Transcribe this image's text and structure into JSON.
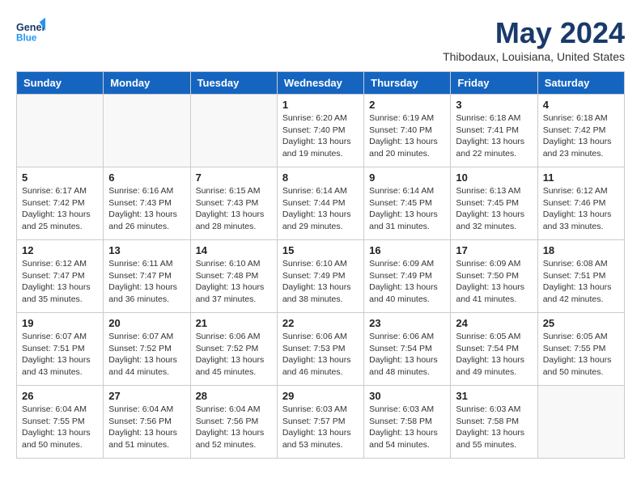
{
  "header": {
    "logo_line1": "General",
    "logo_line2": "Blue",
    "month": "May 2024",
    "location": "Thibodaux, Louisiana, United States"
  },
  "weekdays": [
    "Sunday",
    "Monday",
    "Tuesday",
    "Wednesday",
    "Thursday",
    "Friday",
    "Saturday"
  ],
  "weeks": [
    [
      {
        "day": "",
        "empty": true
      },
      {
        "day": "",
        "empty": true
      },
      {
        "day": "",
        "empty": true
      },
      {
        "day": "1",
        "sunrise": "6:20 AM",
        "sunset": "7:40 PM",
        "daylight": "13 hours and 19 minutes."
      },
      {
        "day": "2",
        "sunrise": "6:19 AM",
        "sunset": "7:40 PM",
        "daylight": "13 hours and 20 minutes."
      },
      {
        "day": "3",
        "sunrise": "6:18 AM",
        "sunset": "7:41 PM",
        "daylight": "13 hours and 22 minutes."
      },
      {
        "day": "4",
        "sunrise": "6:18 AM",
        "sunset": "7:42 PM",
        "daylight": "13 hours and 23 minutes."
      }
    ],
    [
      {
        "day": "5",
        "sunrise": "6:17 AM",
        "sunset": "7:42 PM",
        "daylight": "13 hours and 25 minutes."
      },
      {
        "day": "6",
        "sunrise": "6:16 AM",
        "sunset": "7:43 PM",
        "daylight": "13 hours and 26 minutes."
      },
      {
        "day": "7",
        "sunrise": "6:15 AM",
        "sunset": "7:43 PM",
        "daylight": "13 hours and 28 minutes."
      },
      {
        "day": "8",
        "sunrise": "6:14 AM",
        "sunset": "7:44 PM",
        "daylight": "13 hours and 29 minutes."
      },
      {
        "day": "9",
        "sunrise": "6:14 AM",
        "sunset": "7:45 PM",
        "daylight": "13 hours and 31 minutes."
      },
      {
        "day": "10",
        "sunrise": "6:13 AM",
        "sunset": "7:45 PM",
        "daylight": "13 hours and 32 minutes."
      },
      {
        "day": "11",
        "sunrise": "6:12 AM",
        "sunset": "7:46 PM",
        "daylight": "13 hours and 33 minutes."
      }
    ],
    [
      {
        "day": "12",
        "sunrise": "6:12 AM",
        "sunset": "7:47 PM",
        "daylight": "13 hours and 35 minutes."
      },
      {
        "day": "13",
        "sunrise": "6:11 AM",
        "sunset": "7:47 PM",
        "daylight": "13 hours and 36 minutes."
      },
      {
        "day": "14",
        "sunrise": "6:10 AM",
        "sunset": "7:48 PM",
        "daylight": "13 hours and 37 minutes."
      },
      {
        "day": "15",
        "sunrise": "6:10 AM",
        "sunset": "7:49 PM",
        "daylight": "13 hours and 38 minutes."
      },
      {
        "day": "16",
        "sunrise": "6:09 AM",
        "sunset": "7:49 PM",
        "daylight": "13 hours and 40 minutes."
      },
      {
        "day": "17",
        "sunrise": "6:09 AM",
        "sunset": "7:50 PM",
        "daylight": "13 hours and 41 minutes."
      },
      {
        "day": "18",
        "sunrise": "6:08 AM",
        "sunset": "7:51 PM",
        "daylight": "13 hours and 42 minutes."
      }
    ],
    [
      {
        "day": "19",
        "sunrise": "6:07 AM",
        "sunset": "7:51 PM",
        "daylight": "13 hours and 43 minutes."
      },
      {
        "day": "20",
        "sunrise": "6:07 AM",
        "sunset": "7:52 PM",
        "daylight": "13 hours and 44 minutes."
      },
      {
        "day": "21",
        "sunrise": "6:06 AM",
        "sunset": "7:52 PM",
        "daylight": "13 hours and 45 minutes."
      },
      {
        "day": "22",
        "sunrise": "6:06 AM",
        "sunset": "7:53 PM",
        "daylight": "13 hours and 46 minutes."
      },
      {
        "day": "23",
        "sunrise": "6:06 AM",
        "sunset": "7:54 PM",
        "daylight": "13 hours and 48 minutes."
      },
      {
        "day": "24",
        "sunrise": "6:05 AM",
        "sunset": "7:54 PM",
        "daylight": "13 hours and 49 minutes."
      },
      {
        "day": "25",
        "sunrise": "6:05 AM",
        "sunset": "7:55 PM",
        "daylight": "13 hours and 50 minutes."
      }
    ],
    [
      {
        "day": "26",
        "sunrise": "6:04 AM",
        "sunset": "7:55 PM",
        "daylight": "13 hours and 50 minutes."
      },
      {
        "day": "27",
        "sunrise": "6:04 AM",
        "sunset": "7:56 PM",
        "daylight": "13 hours and 51 minutes."
      },
      {
        "day": "28",
        "sunrise": "6:04 AM",
        "sunset": "7:56 PM",
        "daylight": "13 hours and 52 minutes."
      },
      {
        "day": "29",
        "sunrise": "6:03 AM",
        "sunset": "7:57 PM",
        "daylight": "13 hours and 53 minutes."
      },
      {
        "day": "30",
        "sunrise": "6:03 AM",
        "sunset": "7:58 PM",
        "daylight": "13 hours and 54 minutes."
      },
      {
        "day": "31",
        "sunrise": "6:03 AM",
        "sunset": "7:58 PM",
        "daylight": "13 hours and 55 minutes."
      },
      {
        "day": "",
        "empty": true
      }
    ]
  ]
}
